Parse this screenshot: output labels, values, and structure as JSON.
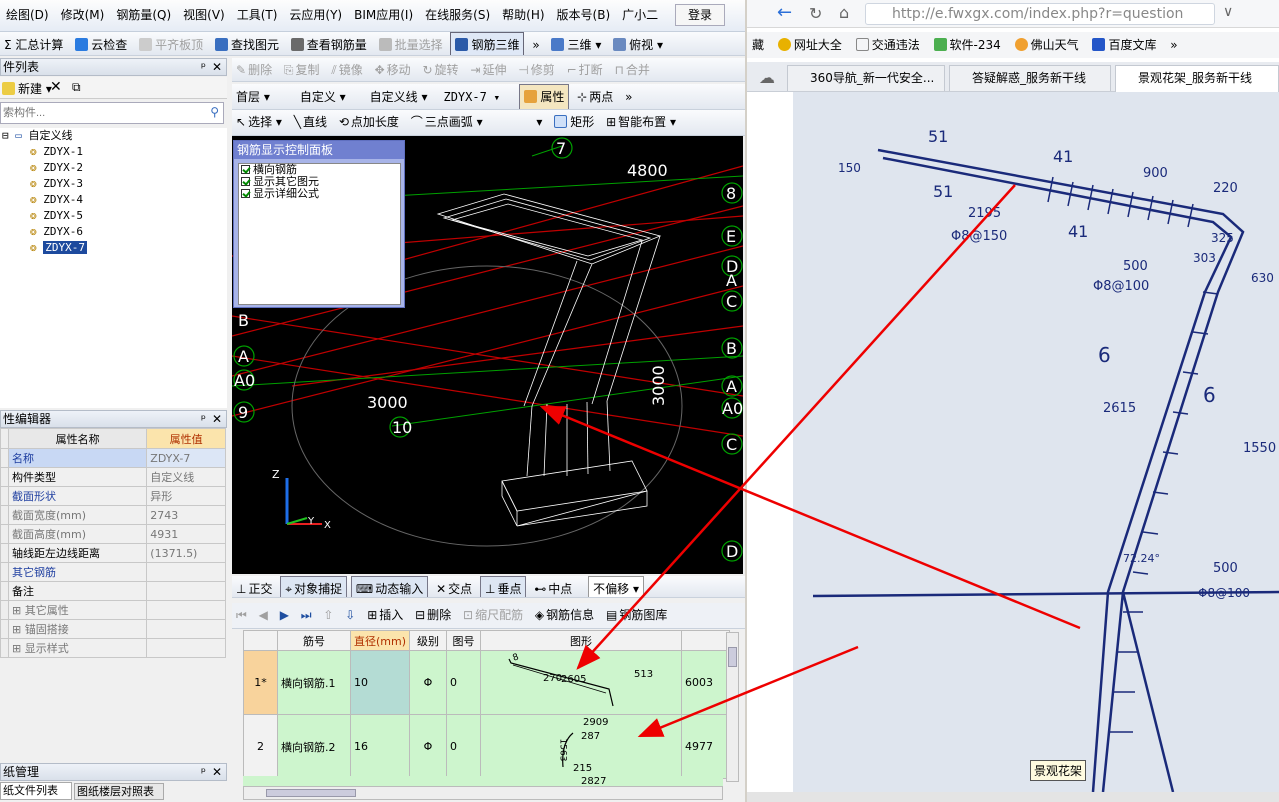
{
  "menu": [
    "绘图(D)",
    "修改(M)",
    "钢筋量(Q)",
    "视图(V)",
    "工具(T)",
    "云应用(Y)",
    "BIM应用(I)",
    "在线服务(S)",
    "帮助(H)",
    "版本号(B)",
    "广小二"
  ],
  "login_label": "登录",
  "toolbar1": {
    "calc": "汇总计算",
    "cloud_check": "云检查",
    "flat_slab": "平齐板顶",
    "find_elem": "查找图元",
    "view_rebar": "查看钢筋量",
    "batch_select": "批量选择",
    "rebar_3d": "钢筋三维",
    "view_3d": "三维",
    "top_view": "俯视"
  },
  "toolbar2": {
    "delete": "删除",
    "copy": "复制",
    "mirror": "镜像",
    "move": "移动",
    "rotate": "旋转",
    "extend": "延伸",
    "trim": "修剪",
    "break": "打断",
    "merge": "合并"
  },
  "toolbar3": {
    "floor": "首层",
    "custom1": "自定义",
    "custom2": "自定义线",
    "element": "ZDYX-7",
    "property": "属性",
    "two_point": "两点"
  },
  "toolbar4": {
    "select": "选择",
    "line": "直线",
    "point_length": "点加长度",
    "arc": "三点画弧",
    "rect": "矩形",
    "smart_layout": "智能布置"
  },
  "component_list": {
    "title": "件列表",
    "new_label": "新建",
    "search_placeholder": "索构件...",
    "root": "自定义线",
    "items": [
      "ZDYX-1",
      "ZDYX-2",
      "ZDYX-3",
      "ZDYX-4",
      "ZDYX-5",
      "ZDYX-6",
      "ZDYX-7"
    ]
  },
  "prop_editor": {
    "title": "性编辑器",
    "col_name": "属性名称",
    "col_value": "属性值",
    "rows": [
      {
        "name": "名称",
        "value": "ZDYX-7"
      },
      {
        "name": "构件类型",
        "value": "自定义线"
      },
      {
        "name": "截面形状",
        "value": "异形"
      },
      {
        "name": "截面宽度(mm)",
        "value": "2743"
      },
      {
        "name": "截面高度(mm)",
        "value": "4931"
      },
      {
        "name": "轴线距左边线距离",
        "value": "(1371.5)"
      },
      {
        "name": "其它钢筋",
        "value": ""
      },
      {
        "name": "备注",
        "value": ""
      },
      {
        "name": "其它属性",
        "value": ""
      },
      {
        "name": "锚固搭接",
        "value": ""
      },
      {
        "name": "显示样式",
        "value": ""
      }
    ]
  },
  "drawing_mgmt": {
    "title": "纸管理",
    "tab1": "纸文件列表",
    "tab2": "图纸楼层对照表"
  },
  "ctrl_panel": {
    "title": "钢筋显示控制面板",
    "opt1": "横向钢筋",
    "opt2": "显示其它图元",
    "opt3": "显示详细公式"
  },
  "view_labels": {
    "dim1": "4800",
    "dim2": "3000",
    "dim3": "3000",
    "axis": [
      "7",
      "8",
      "E",
      "D",
      "A",
      "C",
      "B",
      "A",
      "A0",
      "C",
      "D",
      "B",
      "A",
      "A0",
      "9",
      "10"
    ]
  },
  "status_bar": {
    "ortho": "正交",
    "snap": "对象捕捉",
    "dynamic": "动态输入",
    "intersect": "交点",
    "perp": "垂点",
    "mid": "中点",
    "offset": "不偏移"
  },
  "grid_toolbar": {
    "insert": "插入",
    "delete": "删除",
    "scale": "缩尺配筋",
    "rebar_info": "钢筋信息",
    "rebar_lib": "钢筋图库"
  },
  "rebar_table": {
    "headers": [
      "筋号",
      "直径(mm)",
      "级别",
      "图号",
      "图形",
      ""
    ],
    "rows": [
      {
        "no": "1*",
        "name": "横向钢筋.1",
        "dia": "10",
        "grade": "Φ",
        "fig": "0",
        "shape_labels": [
          "8",
          "270",
          "2605",
          "513"
        ],
        "len": "6003"
      },
      {
        "no": "2",
        "name": "横向钢筋.2",
        "dia": "16",
        "grade": "Φ",
        "fig": "0",
        "shape_labels": [
          "2909",
          "287",
          "1563",
          "215",
          "2827"
        ],
        "len": "4977"
      }
    ]
  },
  "browser": {
    "url": "http://e.fwxgx.com/index.php?r=question",
    "favs": [
      "藏",
      "网址大全",
      "交通违法",
      "软件-234",
      "佛山天气",
      "百度文库"
    ],
    "tabs": [
      "360导航_新一代安全...",
      "答疑解惑_服务新干线",
      "景观花架_服务新干线"
    ],
    "photo_dims": [
      "51",
      "150",
      "41",
      "900",
      "220",
      "51",
      "2195",
      "Φ8@150",
      "41",
      "500",
      "325",
      "303",
      "630",
      "Φ8@100",
      "6",
      "2615",
      "6",
      "1550",
      "72.24°",
      "500",
      "Φ8@100"
    ],
    "caption": "景观花架"
  }
}
